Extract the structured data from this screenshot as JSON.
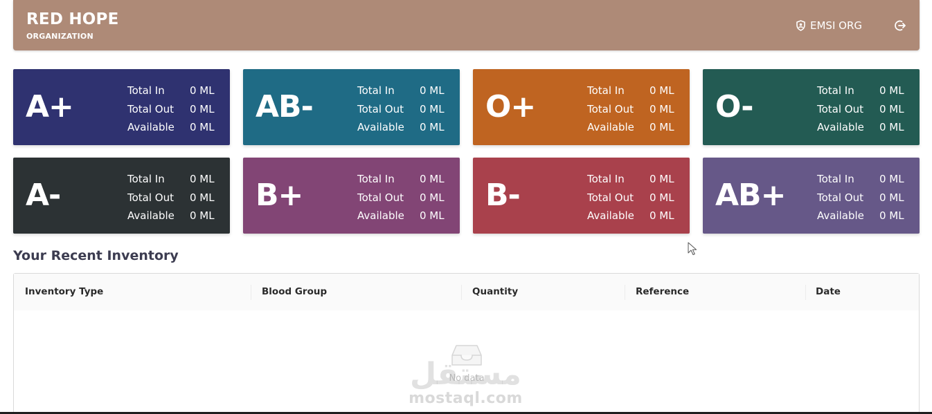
{
  "header": {
    "brand_name": "RED HOPE",
    "brand_sub": "ORGANIZATION",
    "org_name": "EMSI ORG",
    "background": "#ae8a77"
  },
  "cards": [
    {
      "group": "A+",
      "color": "#2f3270",
      "stats": [
        {
          "label": "Total In",
          "value": "0 ML"
        },
        {
          "label": "Total Out",
          "value": "0 ML"
        },
        {
          "label": "Available",
          "value": "0 ML"
        }
      ]
    },
    {
      "group": "AB-",
      "color": "#1f6b85",
      "stats": [
        {
          "label": "Total In",
          "value": "0 ML"
        },
        {
          "label": "Total Out",
          "value": "0 ML"
        },
        {
          "label": "Available",
          "value": "0 ML"
        }
      ]
    },
    {
      "group": "O+",
      "color": "#bf6421",
      "stats": [
        {
          "label": "Total In",
          "value": "0 ML"
        },
        {
          "label": "Total Out",
          "value": "0 ML"
        },
        {
          "label": "Available",
          "value": "0 ML"
        }
      ]
    },
    {
      "group": "O-",
      "color": "#235b53",
      "stats": [
        {
          "label": "Total In",
          "value": "0 ML"
        },
        {
          "label": "Total Out",
          "value": "0 ML"
        },
        {
          "label": "Available",
          "value": "0 ML"
        }
      ]
    },
    {
      "group": "A-",
      "color": "#2c3234",
      "stats": [
        {
          "label": "Total In",
          "value": "0 ML"
        },
        {
          "label": "Total Out",
          "value": "0 ML"
        },
        {
          "label": "Available",
          "value": "0 ML"
        }
      ]
    },
    {
      "group": "B+",
      "color": "#824575",
      "stats": [
        {
          "label": "Total In",
          "value": "0 ML"
        },
        {
          "label": "Total Out",
          "value": "0 ML"
        },
        {
          "label": "Available",
          "value": "0 ML"
        }
      ]
    },
    {
      "group": "B-",
      "color": "#a9414c",
      "stats": [
        {
          "label": "Total In",
          "value": "0 ML"
        },
        {
          "label": "Total Out",
          "value": "0 ML"
        },
        {
          "label": "Available",
          "value": "0 ML"
        }
      ]
    },
    {
      "group": "AB+",
      "color": "#665888",
      "stats": [
        {
          "label": "Total In",
          "value": "0 ML"
        },
        {
          "label": "Total Out",
          "value": "0 ML"
        },
        {
          "label": "Available",
          "value": "0 ML"
        }
      ]
    }
  ],
  "recent": {
    "title": "Your Recent Inventory",
    "columns": [
      "Inventory Type",
      "Blood Group",
      "Quantity",
      "Reference",
      "Date"
    ],
    "empty_text": "No data"
  },
  "watermark": {
    "arabic": "مستقل",
    "latin": "mostaql.com"
  },
  "icons": {
    "org": "shield-user-icon",
    "logout": "logout-icon",
    "empty": "inbox-icon"
  }
}
